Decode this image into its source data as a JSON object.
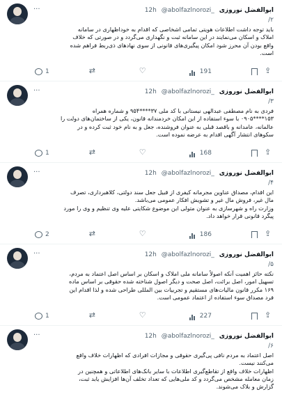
{
  "tweets": [
    {
      "name": "ابوالفضل نوروزی",
      "handle": "@abolfazlnorozi_",
      "time": "12h",
      "more": "···",
      "number": "/۲",
      "text": "باید توجه داشت اطلاعات هویتی تمامی اشخاصی که اقدام به خوداظهاری در سامانه\nاملاک و اسکان می‌نمایند در این سامانه ثبت و نگهداری می‌گردد و در صورتی که خلاف\nواقع بودن آن محرز شود امکان پیگیری‌های قانونی از سوی نهادهای ذی‌ربط فراهم شده\nاست.",
      "replies": "1",
      "retweets": "",
      "likes": "",
      "views": "191"
    },
    {
      "name": "ابوالفضل نوروزی",
      "handle": "@abolfazlnorozi_",
      "time": "12h",
      "more": "···",
      "number": "/۳",
      "text": "فردی به نام مصطفی عبدالهی نیستانی با کد ملی ۳۷****۹۵۴ و شماره همراه\n۱۵۳****۰۹۰۵ با سوء استفاده از این امکان خردمندانه قانون، یکی از ساختمان‌های دولت را\nعالمانه، عامدانه و باقصد قبلی به عنوان فروشنده، جعل و به نام خود ثبت کرده و در\nسکوهای انتشار آگهی اقدام به عرضه نموده است.",
      "replies": "1",
      "retweets": "",
      "likes": "",
      "views": "168"
    },
    {
      "name": "ابوالفضل نوروزی",
      "handle": "@abolfazlnorozi_",
      "time": "12h",
      "more": "···",
      "number": "/۴",
      "text": "این اقدام، مصداق عناوین مجرمانه کیفری از قبیل جعل سند دولتی، کلاهبرداری، تصرف\nمال غیر، فروش مال غیر و تشویش افکار عمومی می‌باشد.\nوزارت راه و شهرسازی به عنوان متولی این موضوع شکایتی علیه وی تنظیم و وی را مورد\nپیگرد قانونی قرار خواهد داد.",
      "replies": "2",
      "retweets": "",
      "likes": "",
      "views": "186"
    },
    {
      "name": "ابوالفضل نوروزی",
      "handle": "@abolfazlnorozi_",
      "time": "12h",
      "more": "···",
      "number": "/۵",
      "text": "نکته حائز اهمیت آنکه اصولاً سامانه ملی املاک و اسکان بر اساس اصل اعتماد به مردم،\nتسهیل امور، اصل برائت، اصل صحت و دیگر اصول شناخته شده حقوقی بر اساس ماده\n۱۶۹ مکرر قانون مالیات‌های مستقیم و تجربیات بین المللی طراحی شده و لذا اقدام این\nفرد مصداق سوء استفاده از اعتماد عمومی است.",
      "replies": "1",
      "retweets": "",
      "likes": "",
      "views": "227"
    },
    {
      "name": "ابوالفضل نوروزی",
      "handle": "@abolfazlnorozi_",
      "time": "12h",
      "more": "···",
      "number": "/۶",
      "text": "اصل اعتماد به مردم نافی پی‌گیری حقوقی و مجازات افرادی که اظهارات خلاف واقع\nمی‌کنند نیست.\nاظهارات خلاف واقع از تقاطع‌گیری اطلاعات با سایر بانک‌های اطلاعاتی و همچنین در\nزمان معامله مشخص می‌گردد و کد ملی‌هایی که تعداد تخلف آن‌ها افزایش یابد ثبت،\nگزارش و بلاک می‌شوند.",
      "replies": "",
      "retweets": "",
      "likes": "",
      "views": ""
    }
  ]
}
